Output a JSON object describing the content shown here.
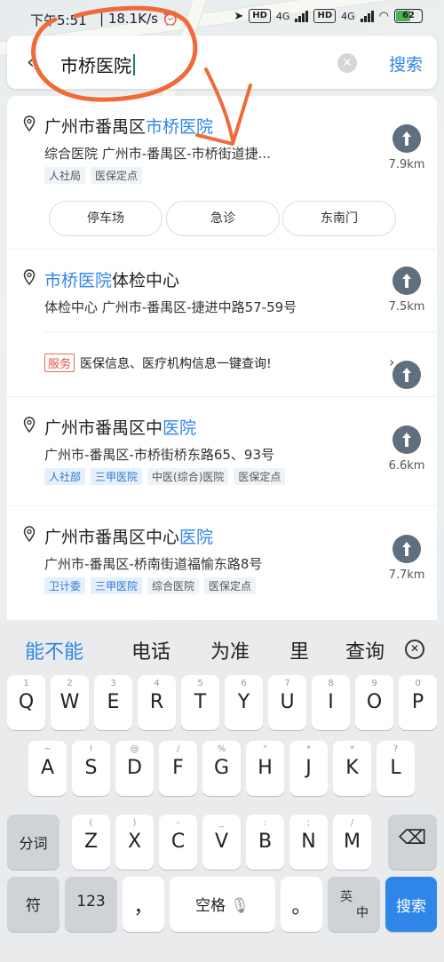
{
  "status_bar": {
    "time": "下午5:51",
    "speed": "18.1K/s",
    "hd": "HD",
    "network": "4G",
    "battery": "62"
  },
  "search": {
    "query": "市桥医院",
    "search_label": "搜索"
  },
  "results": [
    {
      "title_plain": "广州市番禺区",
      "title_highlight": "市桥医院",
      "subtitle": "综合医院  广州市-番禺区-市桥街道捷...",
      "tags": [
        "人社局",
        "医保定点"
      ],
      "distance": "7.9km",
      "chips": [
        "停车场",
        "急诊",
        "东南门"
      ]
    },
    {
      "title_highlight": "市桥医院",
      "title_plain": "体检中心",
      "subtitle": "体检中心  广州市-番禺区-捷进中路57-59号",
      "distance": "7.5km",
      "service_badge": "服务",
      "service_text": "医保信息、医疗机构信息一键查询!"
    },
    {
      "title_plain": "广州市番禺区中",
      "title_highlight": "医院",
      "subtitle": "广州市-番禺区-市桥街桥东路65、93号",
      "tags": [
        "人社部",
        "三甲医院",
        "中医(综合)医院",
        "医保定点"
      ],
      "distance": "6.6km"
    },
    {
      "title_plain": "广州市番禺区中心",
      "title_highlight": "医院",
      "subtitle": "广州市-番禺区-桥南街道福愉东路8号",
      "tags": [
        "卫计委",
        "三甲医院",
        "综合医院",
        "医保定点"
      ],
      "distance": "7.7km"
    }
  ],
  "keyboard": {
    "suggestions": [
      "能不能",
      "电话",
      "为准",
      "里",
      "查询"
    ],
    "row1": [
      {
        "k": "Q",
        "h": "1"
      },
      {
        "k": "W",
        "h": "2"
      },
      {
        "k": "E",
        "h": "3"
      },
      {
        "k": "R",
        "h": "4"
      },
      {
        "k": "T",
        "h": "5"
      },
      {
        "k": "Y",
        "h": "6"
      },
      {
        "k": "U",
        "h": "7"
      },
      {
        "k": "I",
        "h": "8"
      },
      {
        "k": "O",
        "h": "9"
      },
      {
        "k": "P",
        "h": "0"
      }
    ],
    "row2": [
      {
        "k": "A",
        "h": "~"
      },
      {
        "k": "S",
        "h": "!"
      },
      {
        "k": "D",
        "h": "@"
      },
      {
        "k": "F",
        "h": "/"
      },
      {
        "k": "G",
        "h": "%"
      },
      {
        "k": "H",
        "h": "\""
      },
      {
        "k": "J",
        "h": "*"
      },
      {
        "k": "K",
        "h": "*"
      },
      {
        "k": "L",
        "h": "?"
      }
    ],
    "row3": [
      {
        "k": "Z",
        "h": "("
      },
      {
        "k": "X",
        "h": ")"
      },
      {
        "k": "C",
        "h": "-"
      },
      {
        "k": "V",
        "h": "_"
      },
      {
        "k": "B",
        "h": ":"
      },
      {
        "k": "N",
        "h": ";"
      },
      {
        "k": "M",
        "h": "/"
      }
    ],
    "fenci": "分词",
    "fu": "符",
    "num": "123",
    "comma": "，",
    "space": "空格",
    "period": "。",
    "lang_top": "英",
    "lang_bottom": "中",
    "search": "搜索"
  }
}
